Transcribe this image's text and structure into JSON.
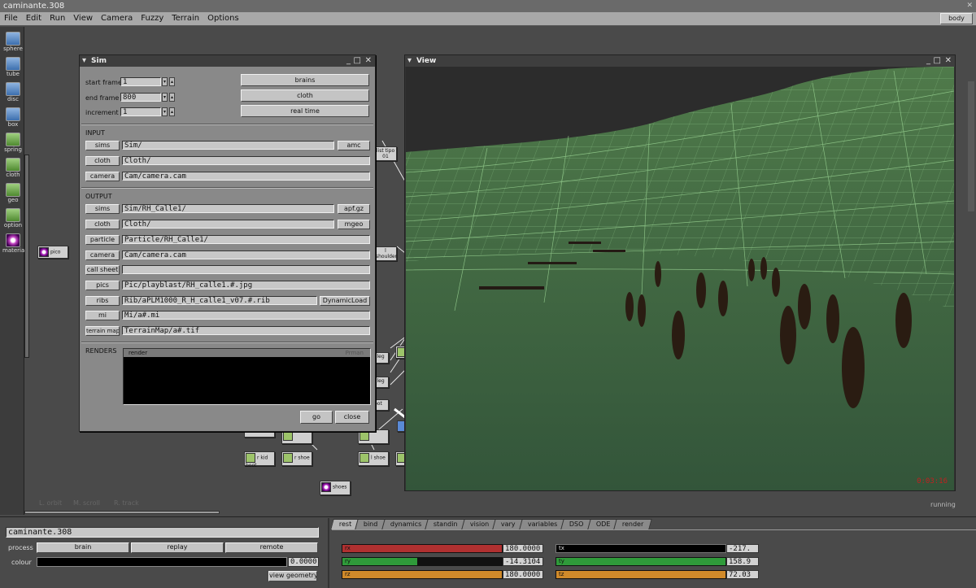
{
  "app": {
    "title": "caminante.308",
    "body_button": "body"
  },
  "menu": [
    "File",
    "Edit",
    "Run",
    "View",
    "Camera",
    "Fuzzy",
    "Terrain",
    "Options"
  ],
  "tools": [
    {
      "label": "sphere",
      "icon": "sphere-icon"
    },
    {
      "label": "tube",
      "icon": "tube-icon"
    },
    {
      "label": "disc",
      "icon": "disc-icon"
    },
    {
      "label": "box",
      "icon": "box-icon"
    },
    {
      "label": "spring",
      "icon": "spring-icon"
    },
    {
      "label": "cloth",
      "icon": "cloth-icon"
    },
    {
      "label": "geo",
      "icon": "geo-icon"
    },
    {
      "label": "option",
      "icon": "option-icon"
    },
    {
      "label": "material",
      "icon": "material-icon"
    }
  ],
  "graph": {
    "nodes": {
      "pico": "pico",
      "list_tipo": "list tipo 01",
      "shoulder": "l shoulder",
      "v_leg1": "v leg",
      "v_leg2": "v leg",
      "foot": "foot",
      "r_kid_boot": "r kid boot",
      "r_shoe": "r shoe",
      "l_shoe": "l shoe",
      "shoes": "shoes"
    },
    "hints": {
      "orbit": "L. orbit",
      "scroll": "M. scroll",
      "track": "R. track"
    }
  },
  "sim": {
    "title": "Sim",
    "start_frame": {
      "label": "start frame",
      "value": "1"
    },
    "end_frame": {
      "label": "end frame",
      "value": "800"
    },
    "increment": {
      "label": "increment",
      "value": "1"
    },
    "buttons": {
      "brains": "brains",
      "cloth": "cloth",
      "realtime": "real time",
      "go": "go",
      "close": "close"
    },
    "input": {
      "header": "INPUT",
      "sims": {
        "label": "sims",
        "value": "Sim/",
        "extra": "amc"
      },
      "cloth": {
        "label": "cloth",
        "value": "Cloth/"
      },
      "camera": {
        "label": "camera",
        "value": "Cam/camera.cam"
      }
    },
    "output": {
      "header": "OUTPUT",
      "sims": {
        "label": "sims",
        "value": "Sim/RH_Calle1/",
        "extra": "apf.gz"
      },
      "cloth": {
        "label": "cloth",
        "value": "Cloth/",
        "extra": "mgeo"
      },
      "particle": {
        "label": "particle",
        "value": "Particle/RH_Calle1/"
      },
      "camera": {
        "label": "camera",
        "value": "Cam/camera.cam"
      },
      "callsheet": {
        "label": "call sheet",
        "value": ""
      },
      "pics": {
        "label": "pics",
        "value": "Pic/playblast/RH_calle1.#.jpg"
      },
      "ribs": {
        "label": "ribs",
        "value": "Rib/aPLM1000_R_H_calle1_v07.#.rib",
        "extra": "DynamicLoad"
      },
      "mi": {
        "label": "mi",
        "value": "Mi/a#.mi"
      },
      "terrainmap": {
        "label": "terrain map",
        "value": "TerrainMap/a#.tif"
      }
    },
    "renders": {
      "header": "RENDERS",
      "col1": "render",
      "col2": "Prman"
    }
  },
  "view": {
    "title": "View",
    "timer": "0:03:16",
    "status": "running"
  },
  "bottom": {
    "name": "caminante.308",
    "process_label": "process",
    "process_buttons": [
      "brain",
      "replay",
      "remote"
    ],
    "colour_label": "colour",
    "colour_value": "0.0000",
    "view_geometry": "view geometry",
    "tabs": [
      "rest",
      "bind",
      "dynamics",
      "standin",
      "vision",
      "vary",
      "variables",
      "DSO",
      "ODE",
      "render"
    ],
    "sliders_left": [
      {
        "tag": "rx",
        "value": "180.0000",
        "color": "#b03030"
      },
      {
        "tag": "ry",
        "value": "-14.3104",
        "color": "#2f9a3a"
      },
      {
        "tag": "rz",
        "value": "180.0000",
        "color": "#d08a2a"
      }
    ],
    "sliders_right": [
      {
        "tag": "tx",
        "value": "-217.",
        "color": "#000000"
      },
      {
        "tag": "ty",
        "value": "158.9",
        "color": "#2f9a3a"
      },
      {
        "tag": "tz",
        "value": "72.03",
        "color": "#d08a2a"
      }
    ]
  }
}
